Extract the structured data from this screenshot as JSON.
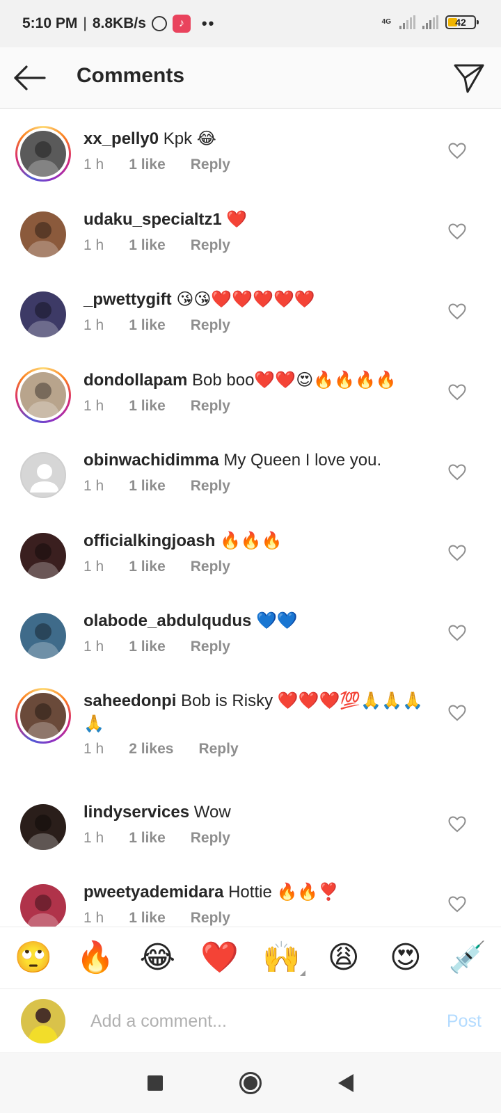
{
  "status_bar": {
    "time": "5:10 PM",
    "separator": "|",
    "speed": "8.8KB/s",
    "network": "4G",
    "battery": "42",
    "battery_level_percent": 42
  },
  "header": {
    "title": "Comments"
  },
  "comments": [
    {
      "username": "xx_pelly0",
      "text": "Kpk 😂",
      "time": "1 h",
      "likes": "1 like",
      "reply": "Reply",
      "avatar_ring": true,
      "avatar_color": "#5a5a5a"
    },
    {
      "username": "udaku_specialtz1",
      "text": "❤️",
      "time": "1 h",
      "likes": "1 like",
      "reply": "Reply",
      "avatar_ring": false,
      "avatar_color": "#8b5a3c"
    },
    {
      "username": "_pwettygift",
      "text": "😘😘❤️❤️❤️❤️❤️",
      "time": "1 h",
      "likes": "1 like",
      "reply": "Reply",
      "avatar_ring": false,
      "avatar_color": "#3d3a66"
    },
    {
      "username": "dondollapam",
      "text": "Bob boo❤️❤️😍🔥🔥🔥🔥",
      "time": "1 h",
      "likes": "1 like",
      "reply": "Reply",
      "avatar_ring": true,
      "avatar_color": "#b8a48c"
    },
    {
      "username": "obinwachidimma",
      "text": "My Queen I love you.",
      "time": "1 h",
      "likes": "1 like",
      "reply": "Reply",
      "avatar_ring": false,
      "avatar_color": "#d6d6d6"
    },
    {
      "username": "officialkingjoash",
      "text": "🔥🔥🔥",
      "time": "1 h",
      "likes": "1 like",
      "reply": "Reply",
      "avatar_ring": false,
      "avatar_color": "#3a1f1f"
    },
    {
      "username": "olabode_abdulqudus",
      "text": "💙💙",
      "time": "1 h",
      "likes": "1 like",
      "reply": "Reply",
      "avatar_ring": false,
      "avatar_color": "#3f6b8a"
    },
    {
      "username": "saheedonpi",
      "text": "Bob is Risky ❤️❤️❤️💯🙏🙏🙏🙏",
      "time": "1 h",
      "likes": "2 likes",
      "reply": "Reply",
      "avatar_ring": true,
      "avatar_color": "#6a4a3a"
    },
    {
      "username": "lindyservices",
      "text": "Wow",
      "time": "1 h",
      "likes": "1 like",
      "reply": "Reply",
      "avatar_ring": false,
      "avatar_color": "#2a1e1a"
    },
    {
      "username": "pweetyademidara",
      "text": "Hottie 🔥🔥❣️",
      "time": "1 h",
      "likes": "1 like",
      "reply": "Reply",
      "avatar_ring": false,
      "avatar_color": "#b0334a"
    }
  ],
  "emoji_bar": [
    "🙄",
    "🔥",
    "😂",
    "❤️",
    "🙌",
    "😩",
    "😍",
    "💉"
  ],
  "input": {
    "placeholder": "Add a comment...",
    "post_label": "Post",
    "self_avatar_color": "#e6d23a"
  },
  "icons": {
    "back": "back-arrow-icon",
    "send": "direct-send-icon",
    "heart": "heart-outline-icon",
    "nav": [
      "recents-square-icon",
      "home-circle-icon",
      "back-triangle-icon"
    ]
  },
  "colors": {
    "accent_blue_disabled": "#b3dbff",
    "meta_gray": "#8e8e8e",
    "text": "#262626"
  }
}
